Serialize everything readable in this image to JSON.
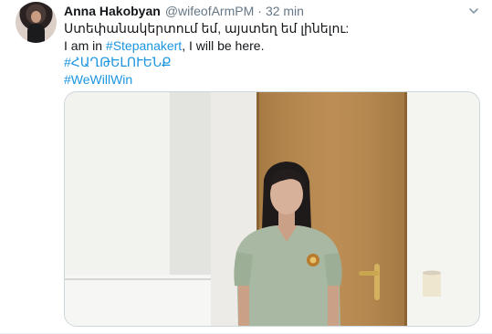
{
  "tweet": {
    "author_name": "Anna Hakobyan",
    "handle": "@wifeofArmPM",
    "separator": "·",
    "time": "32 min",
    "lines": {
      "armenian": "Ստեփանակերտում եմ, այստեղ եմ լինելու:",
      "prefix": "I am in ",
      "place_link": "#Stepanakert",
      "suffix": ", I will be here.",
      "hashtag_armenian": "#ՀԱՂԹԵԼՈՒԵՆՔ",
      "hashtag_english": "#WeWillWin"
    }
  },
  "icons": {
    "avatar": "profile-photo",
    "menu": "chevron-down-icon"
  },
  "colors": {
    "link": "#1b95e0",
    "muted": "#657786",
    "text": "#14171a",
    "door": "#b8874a",
    "shirt": "#a8b8a2"
  }
}
